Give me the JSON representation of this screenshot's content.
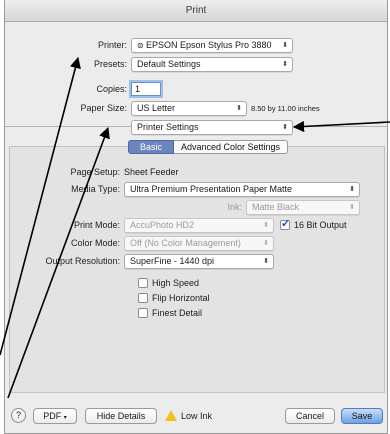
{
  "window": {
    "title": "Print"
  },
  "printer": {
    "label": "Printer:",
    "value": "EPSON Epson Stylus Pro 3880",
    "icon": "printer-status-icon"
  },
  "presets": {
    "label": "Presets:",
    "value": "Default Settings"
  },
  "copies": {
    "label": "Copies:",
    "value": "1"
  },
  "paper_size": {
    "label": "Paper Size:",
    "value": "US Letter",
    "dimensions": "8.50 by 11.00 inches"
  },
  "section_popup": {
    "value": "Printer Settings"
  },
  "tabs": {
    "basic": "Basic",
    "advanced": "Advanced Color Settings"
  },
  "page_setup": {
    "label": "Page Setup:",
    "value": "Sheet Feeder"
  },
  "media_type": {
    "label": "Media Type:",
    "value": "Ultra Premium Presentation Paper Matte"
  },
  "ink": {
    "label": "Ink:",
    "value": "Matte Black"
  },
  "print_mode": {
    "label": "Print Mode:",
    "value": "AccuPhoto HD2",
    "checkbox_label": "16 Bit Output",
    "checkbox_checked": true
  },
  "color_mode": {
    "label": "Color Mode:",
    "value": "Off (No Color Management)"
  },
  "output_resolution": {
    "label": "Output Resolution:",
    "value": "SuperFine - 1440 dpi"
  },
  "options": {
    "high_speed": {
      "label": "High Speed",
      "checked": false
    },
    "flip_horizontal": {
      "label": "Flip Horizontal",
      "checked": false
    },
    "finest_detail": {
      "label": "Finest Detail",
      "checked": false
    }
  },
  "footer": {
    "help": "?",
    "pdf": "PDF",
    "hide_details": "Hide Details",
    "low_ink": "Low Ink",
    "cancel": "Cancel",
    "save": "Save"
  },
  "colors": {
    "accent": "#6b86bd",
    "default_button": "#6fa2e4",
    "warning": "#f3c11b"
  }
}
